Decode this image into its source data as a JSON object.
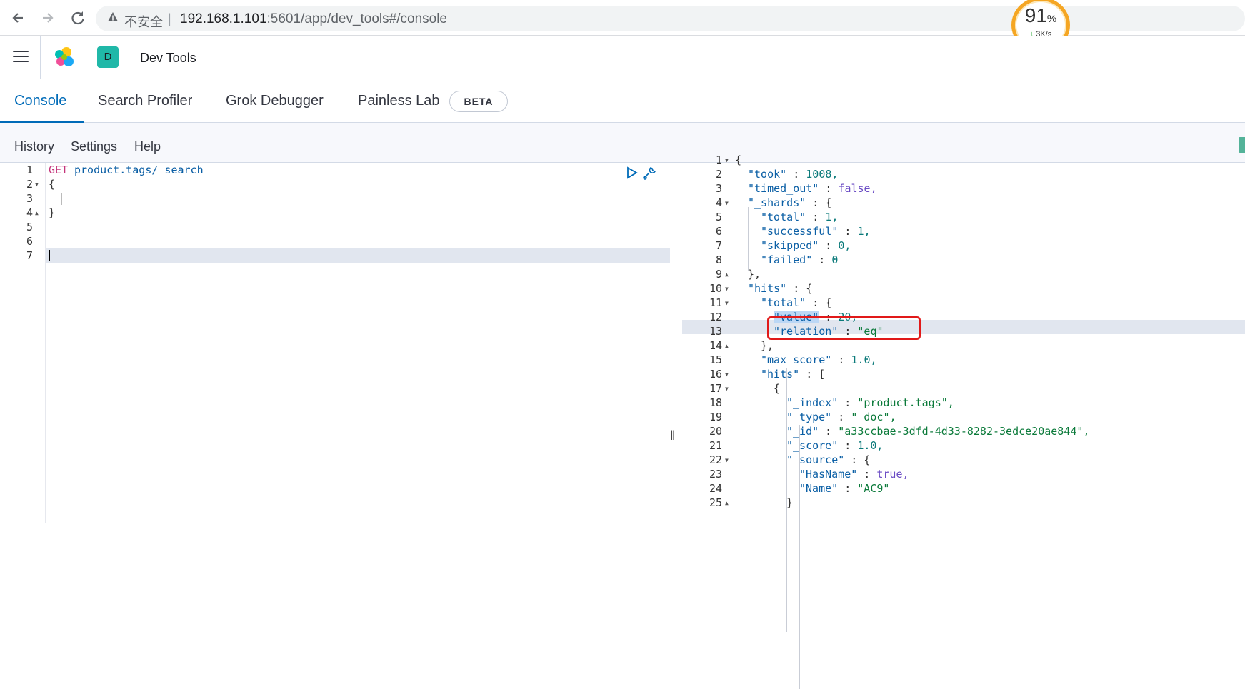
{
  "browser": {
    "security_label": "不安全",
    "url_host": "192.168.1.101",
    "url_rest": ":5601/app/dev_tools#/console",
    "net_percent": "91",
    "net_percent_unit": "%",
    "net_speed": "3K/s"
  },
  "header": {
    "space_initial": "D",
    "app_title": "Dev Tools"
  },
  "tabs": [
    {
      "label": "Console",
      "selected": true
    },
    {
      "label": "Search Profiler",
      "selected": false
    },
    {
      "label": "Grok Debugger",
      "selected": false
    },
    {
      "label": "Painless Lab",
      "selected": false
    }
  ],
  "beta_badge": "BETA",
  "console_menu": {
    "history": "History",
    "settings": "Settings",
    "help": "Help"
  },
  "request": {
    "lines": [
      {
        "n": "1",
        "method": "GET",
        "path": "product.tags/_search"
      },
      {
        "n": "2",
        "text": "{"
      },
      {
        "n": "3",
        "text": ""
      },
      {
        "n": "4",
        "text": "}"
      },
      {
        "n": "5",
        "text": ""
      },
      {
        "n": "6",
        "text": ""
      },
      {
        "n": "7",
        "text": ""
      }
    ]
  },
  "response": {
    "lines": [
      {
        "n": "1",
        "text": "{"
      },
      {
        "n": "2",
        "key": "\"took\"",
        "val": "1008,",
        "t": "n"
      },
      {
        "n": "3",
        "key": "\"timed_out\"",
        "val": "false,",
        "t": "b"
      },
      {
        "n": "4",
        "key": "\"_shards\"",
        "val": "{",
        "t": "p"
      },
      {
        "n": "5",
        "key": "\"total\"",
        "val": "1,",
        "t": "n"
      },
      {
        "n": "6",
        "key": "\"successful\"",
        "val": "1,",
        "t": "n"
      },
      {
        "n": "7",
        "key": "\"skipped\"",
        "val": "0,",
        "t": "n"
      },
      {
        "n": "8",
        "key": "\"failed\"",
        "val": "0",
        "t": "n"
      },
      {
        "n": "9",
        "text": "},"
      },
      {
        "n": "10",
        "key": "\"hits\"",
        "val": "{",
        "t": "p"
      },
      {
        "n": "11",
        "key": "\"total\"",
        "val": "{",
        "t": "p"
      },
      {
        "n": "12",
        "key": "\"value\"",
        "val": "20,",
        "t": "n"
      },
      {
        "n": "13",
        "key": "\"relation\"",
        "val": "\"eq\"",
        "t": "s"
      },
      {
        "n": "14",
        "text": "},"
      },
      {
        "n": "15",
        "key": "\"max_score\"",
        "val": "1.0,",
        "t": "n"
      },
      {
        "n": "16",
        "key": "\"hits\"",
        "val": "[",
        "t": "p"
      },
      {
        "n": "17",
        "text": "{"
      },
      {
        "n": "18",
        "key": "\"_index\"",
        "val": "\"product.tags\",",
        "t": "s"
      },
      {
        "n": "19",
        "key": "\"_type\"",
        "val": "\"_doc\",",
        "t": "s"
      },
      {
        "n": "20",
        "key": "\"_id\"",
        "val": "\"a33ccbae-3dfd-4d33-8282-3edce20ae844\",",
        "t": "s"
      },
      {
        "n": "21",
        "key": "\"_score\"",
        "val": "1.0,",
        "t": "n"
      },
      {
        "n": "22",
        "key": "\"_source\"",
        "val": "{",
        "t": "p"
      },
      {
        "n": "23",
        "key": "\"HasName\"",
        "val": "true,",
        "t": "b"
      },
      {
        "n": "24",
        "key": "\"Name\"",
        "val": "\"AC9\"",
        "t": "s"
      },
      {
        "n": "25",
        "text": "}"
      }
    ]
  }
}
